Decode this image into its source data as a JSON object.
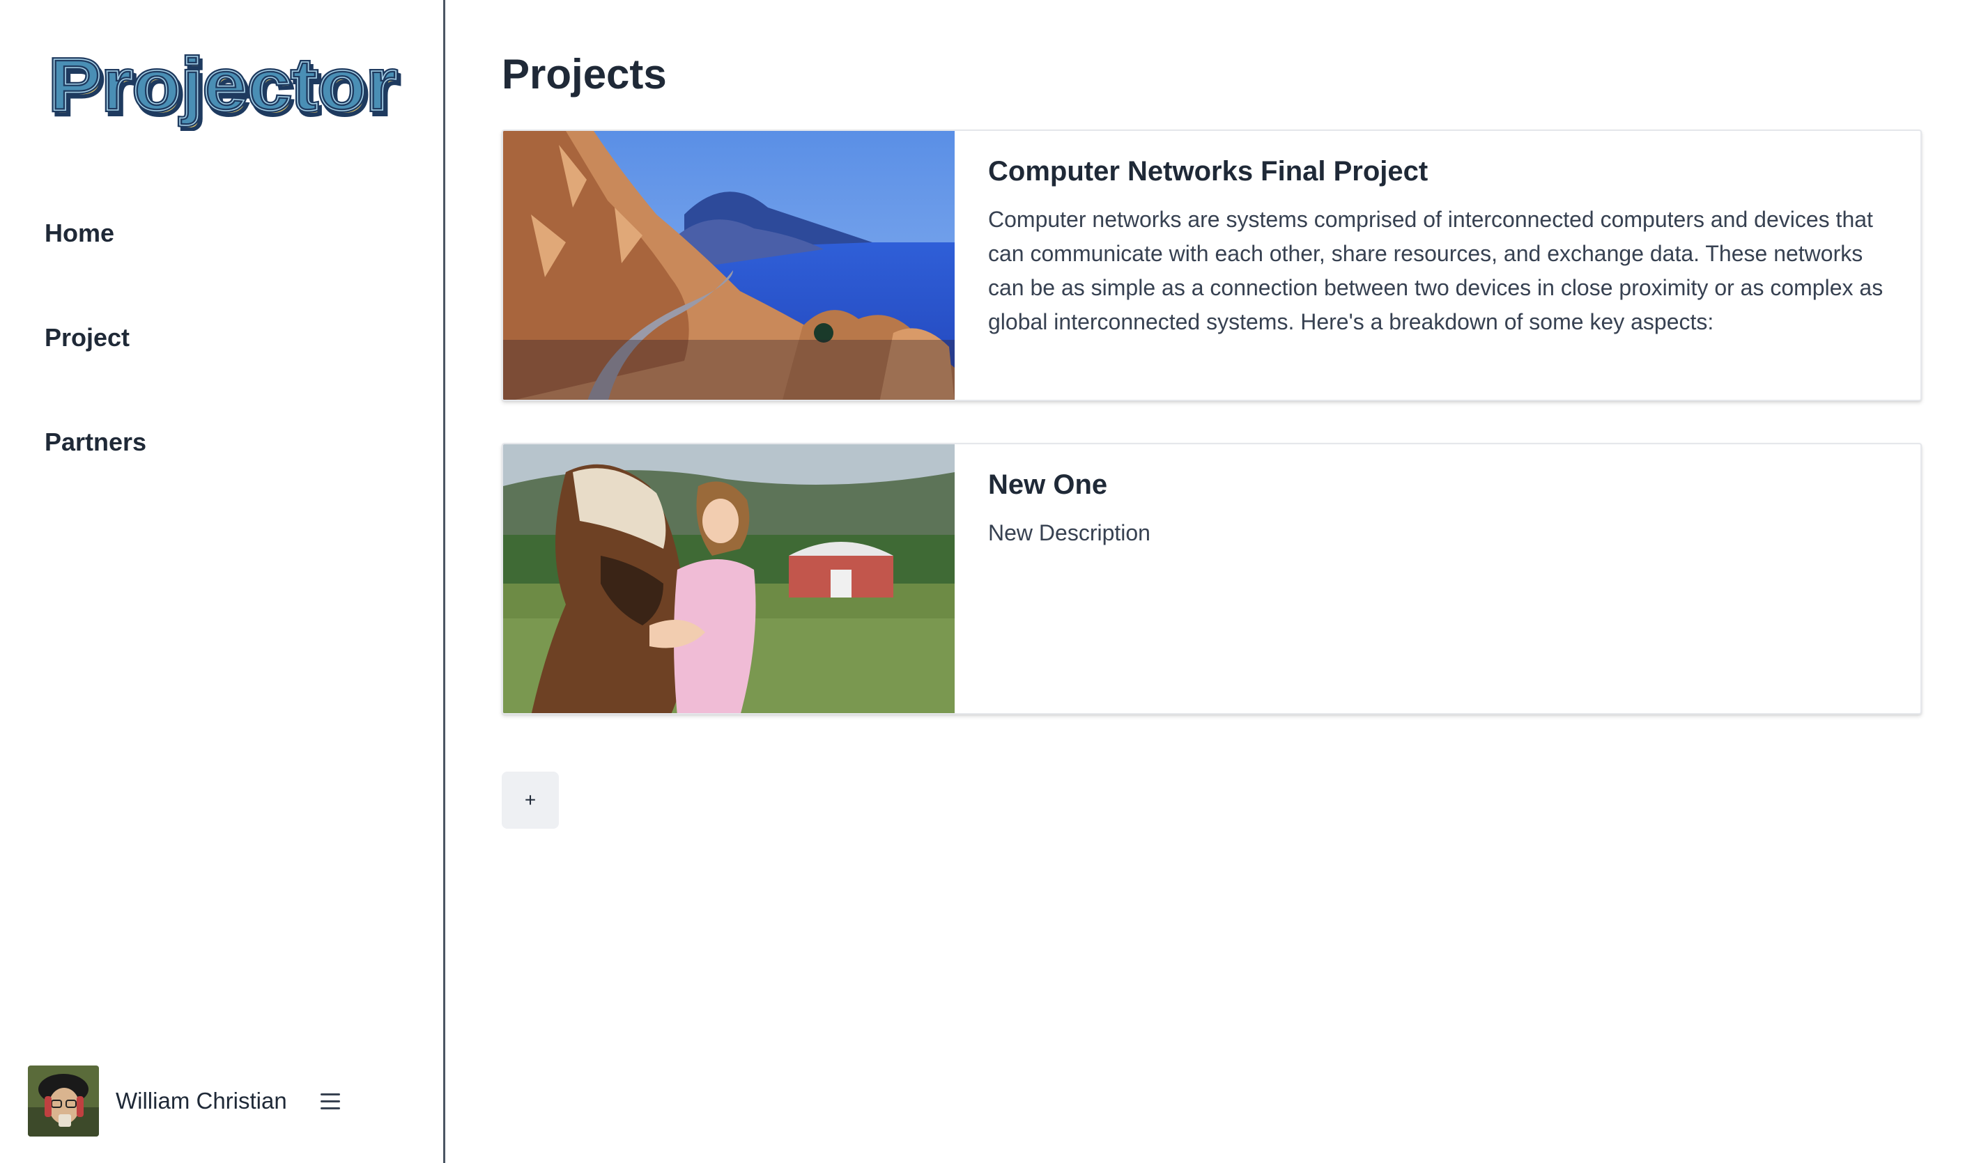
{
  "sidebar": {
    "logo_text": "Projector",
    "nav": [
      {
        "label": "Home"
      },
      {
        "label": "Project"
      },
      {
        "label": "Partners"
      }
    ],
    "user": {
      "name": "William Christian",
      "menu_icon": "hamburger-menu-icon"
    }
  },
  "main": {
    "title": "Projects",
    "projects": [
      {
        "title": "Computer Networks Final Project",
        "description": "Computer networks are systems comprised of interconnected computers and devices that can communicate with each other, share resources, and exchange data. These networks can be as simple as a connection between two devices in close proximity or as complex as global interconnected systems. Here's a breakdown of some key aspects:",
        "image": "coastal-road-illustration"
      },
      {
        "title": "New One",
        "description": "New Description",
        "image": "girl-with-pony-photo"
      }
    ],
    "add_button_label": "+"
  },
  "colors": {
    "logo_fill": "#4a8fb5",
    "logo_outline": "#1e3a5f",
    "logo_shadow": "#f2d36b",
    "sidebar_border": "#4b5563",
    "add_button_bg": "#eef0f3"
  }
}
